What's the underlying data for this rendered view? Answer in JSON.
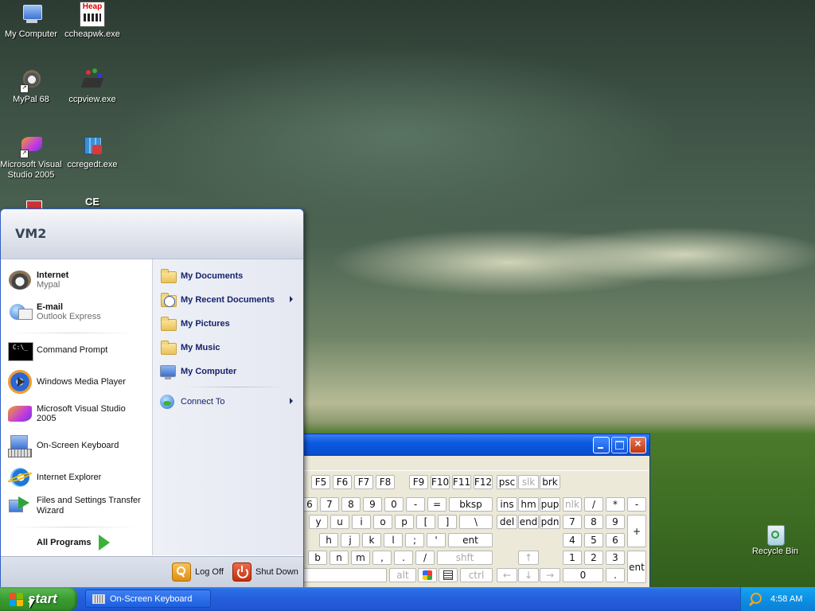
{
  "desktop": {
    "icons": [
      {
        "label": "My Computer"
      },
      {
        "label": "ccheapwk.exe",
        "badge": "Heap"
      },
      {
        "label": "MyPal 68"
      },
      {
        "label": "ccpview.exe"
      },
      {
        "label": "Microsoft Visual Studio 2005"
      },
      {
        "label": "ccregedt.exe"
      },
      {
        "label": "CE"
      }
    ],
    "recycle_bin": "Recycle Bin"
  },
  "start_menu": {
    "user": "VM2",
    "pinned": [
      {
        "title": "Internet",
        "subtitle": "Mypal",
        "icon": "mypal-icon"
      },
      {
        "title": "E-mail",
        "subtitle": "Outlook Express",
        "icon": "outlook-express-icon"
      }
    ],
    "recent": [
      {
        "title": "Command Prompt",
        "icon": "command-prompt-icon"
      },
      {
        "title": "Windows Media Player",
        "icon": "media-player-icon"
      },
      {
        "title": "Microsoft Visual Studio 2005",
        "icon": "visual-studio-icon"
      },
      {
        "title": "On-Screen Keyboard",
        "icon": "keyboard-icon"
      },
      {
        "title": "Internet Explorer",
        "icon": "internet-explorer-icon"
      },
      {
        "title": "Files and Settings Transfer Wizard",
        "icon": "transfer-wizard-icon"
      }
    ],
    "all_programs": "All Programs",
    "places": [
      {
        "label": "My Documents"
      },
      {
        "label": "My Recent Documents"
      },
      {
        "label": "My Pictures"
      },
      {
        "label": "My Music"
      },
      {
        "label": "My Computer"
      }
    ],
    "connect_to": "Connect To",
    "log_off": "Log Off",
    "shut_down": "Shut Down"
  },
  "osk_keys": {
    "row0": [
      "F5",
      "F6",
      "F7",
      "F8",
      "F9",
      "F10",
      "F11",
      "F12",
      "psc",
      "slk",
      "brk"
    ],
    "row1": [
      "6",
      "7",
      "8",
      "9",
      "0",
      "-",
      "=",
      "bksp",
      "ins",
      "hm",
      "pup",
      "nlk",
      "/",
      "*",
      "-"
    ],
    "row2": [
      "y",
      "u",
      "i",
      "o",
      "p",
      "[",
      "]",
      "\\",
      "del",
      "end",
      "pdn",
      "7",
      "8",
      "9",
      "+"
    ],
    "row3": [
      "h",
      "j",
      "k",
      "l",
      ";",
      "'",
      "ent",
      "4",
      "5",
      "6"
    ],
    "row4": [
      "b",
      "n",
      "m",
      ",",
      ".",
      "/",
      "shft",
      "1",
      "2",
      "3",
      "ent"
    ],
    "row5": [
      "alt",
      "ctrl",
      "0",
      "."
    ]
  },
  "taskbar": {
    "start": "start",
    "tasks": [
      "On-Screen Keyboard"
    ],
    "clock": "4:58 AM"
  }
}
